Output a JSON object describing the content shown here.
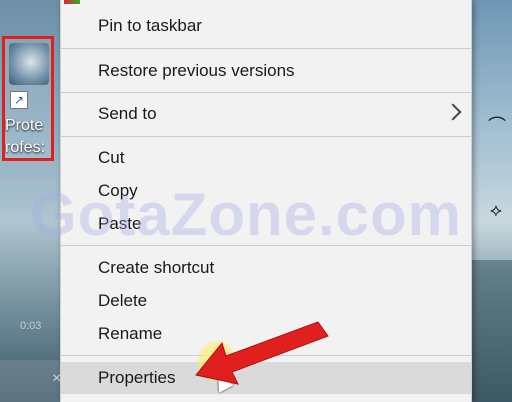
{
  "desktop": {
    "icon_label_line1": "Prote",
    "icon_label_line2": "rofes:",
    "watermark": "GotaZone.com",
    "timecode": "0:03",
    "close_glyph": "×"
  },
  "context_menu": {
    "items": [
      {
        "label": "Pin to taskbar"
      },
      {
        "label": "Restore previous versions"
      },
      {
        "label": "Send to",
        "submenu": true
      },
      {
        "label": "Cut"
      },
      {
        "label": "Copy"
      },
      {
        "label": "Paste"
      },
      {
        "label": "Create shortcut"
      },
      {
        "label": "Delete"
      },
      {
        "label": "Rename"
      },
      {
        "label": "Properties",
        "highlighted": true
      }
    ]
  },
  "annotation": {
    "arrow_color": "#e01f1f",
    "box_color": "#e01f1f",
    "highlight_color": "#ffe85a"
  }
}
